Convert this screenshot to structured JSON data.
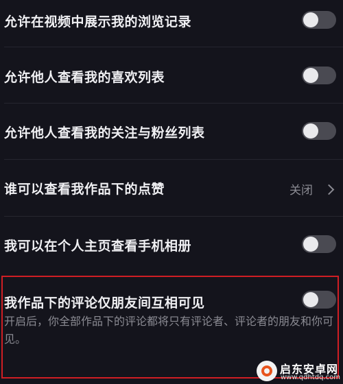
{
  "settings": {
    "rows": [
      {
        "label": "允许在视频中展示我的浏览记录",
        "toggle_on": false
      },
      {
        "label": "允许他人查看我的喜欢列表",
        "toggle_on": false
      },
      {
        "label": "允许他人查看我的关注与粉丝列表",
        "toggle_on": false
      },
      {
        "label": "谁可以查看我作品下的点赞",
        "value": "关闭"
      },
      {
        "label": "我可以在个人主页查看手机相册",
        "toggle_on": false
      },
      {
        "label": "我作品下的评论仅朋友间互相可见",
        "toggle_on": false,
        "description": "开启后，你全部作品下的评论都将只有评论者、评论者的朋友和你可见。"
      }
    ]
  },
  "watermark": {
    "title": "启东安卓网",
    "url": "www.qdhtdq.com"
  },
  "colors": {
    "background": "#14141c",
    "toggle_track_off": "#4a4a52",
    "toggle_knob": "#e9e9ec",
    "highlight_border": "#d01e24"
  }
}
